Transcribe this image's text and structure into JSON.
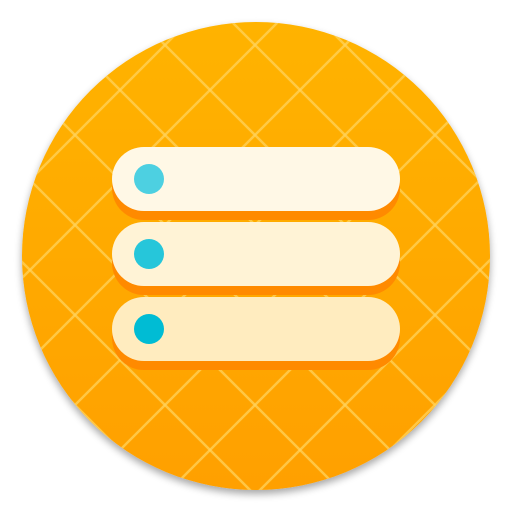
{
  "app_icon": {
    "icon": "server-stack-icon",
    "shape": "circle",
    "colors": {
      "background_top": "#ffb300",
      "background_bottom": "#ffa000",
      "pattern_lines": "#ffd35c",
      "plate_shadow": "#ff8a00",
      "plate_top": "#fff8e6",
      "plate_middle": "#fff3d6",
      "plate_bottom": "#ffecbf",
      "dot_top": "#4dd0e1",
      "dot_middle": "#26c6da",
      "dot_bottom": "#00bcd4"
    },
    "rows": [
      {
        "name": "server-row-top",
        "indicator": "dot"
      },
      {
        "name": "server-row-middle",
        "indicator": "dot"
      },
      {
        "name": "server-row-bottom",
        "indicator": "dot"
      }
    ]
  }
}
